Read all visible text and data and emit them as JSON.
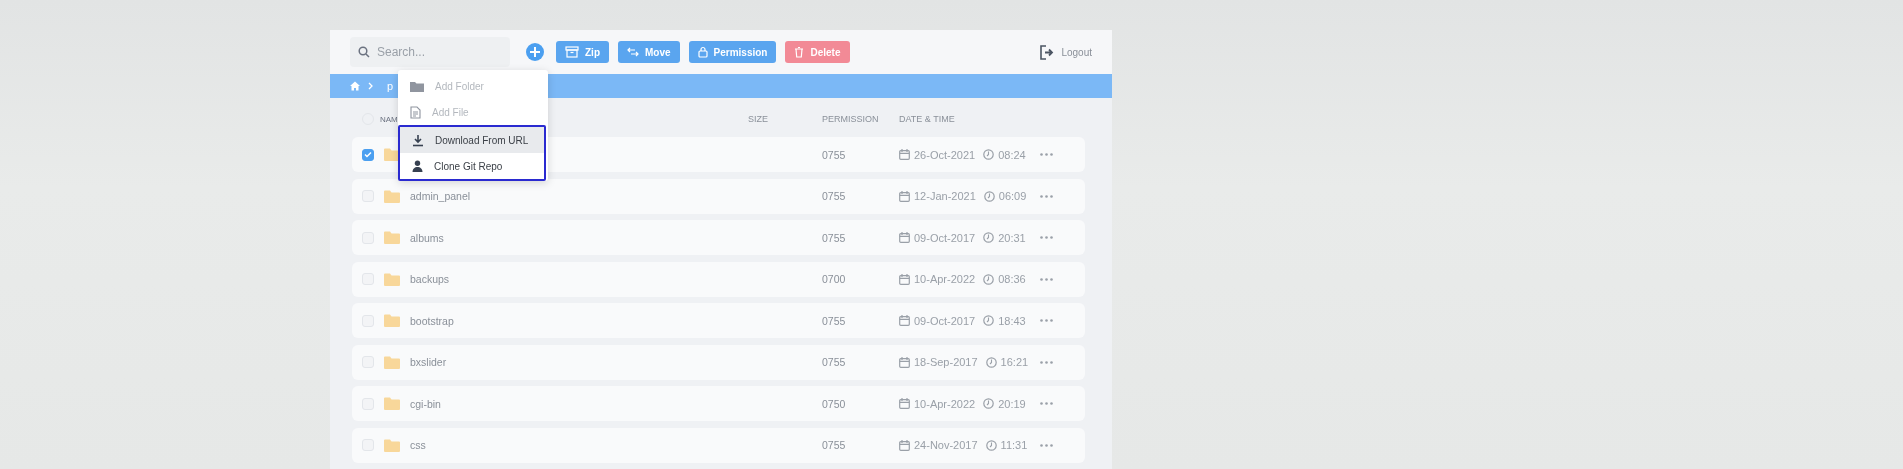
{
  "toolbar": {
    "search": {
      "placeholder": "Search..."
    },
    "buttons": [
      {
        "label": "Zip",
        "kind": "zip"
      },
      {
        "label": "Move",
        "kind": "move"
      },
      {
        "label": "Permission",
        "kind": "permission"
      },
      {
        "label": "Delete",
        "kind": "delete"
      }
    ],
    "logout": "Logout"
  },
  "breadcrumb": {
    "current": "p"
  },
  "add_menu": {
    "items": [
      {
        "label": "Add Folder",
        "kind": "folder",
        "selected": false,
        "disabled": true,
        "outlined": false
      },
      {
        "label": "Add File",
        "kind": "file",
        "selected": false,
        "disabled": true,
        "outlined": false
      },
      {
        "label": "Download From URL",
        "kind": "download",
        "selected": true,
        "disabled": false,
        "outlined": true
      },
      {
        "label": "Clone Git Repo",
        "kind": "user",
        "selected": false,
        "disabled": false,
        "outlined": true
      }
    ]
  },
  "table": {
    "select_all_checked": false,
    "columns": [
      "NAM",
      "SIZE",
      "PERMISSION",
      "DATE & TIME"
    ],
    "rows": [
      {
        "checked": true,
        "permission": "0755",
        "date": "26-Oct-2021",
        "time": "08:24"
      },
      {
        "checked": false,
        "name": "admin_panel",
        "permission": "0755",
        "date": "12-Jan-2021",
        "time": "06:09"
      },
      {
        "checked": false,
        "name": "albums",
        "permission": "0755",
        "date": "09-Oct-2017",
        "time": "20:31"
      },
      {
        "checked": false,
        "name": "backups",
        "permission": "0700",
        "date": "10-Apr-2022",
        "time": "08:36"
      },
      {
        "checked": false,
        "name": "bootstrap",
        "permission": "0755",
        "date": "09-Oct-2017",
        "time": "18:43"
      },
      {
        "checked": false,
        "name": "bxslider",
        "permission": "0755",
        "date": "18-Sep-2017",
        "time": "16:21"
      },
      {
        "checked": false,
        "name": "cgi-bin",
        "permission": "0750",
        "date": "10-Apr-2022",
        "time": "20:19"
      },
      {
        "checked": false,
        "name": "css",
        "permission": "0755",
        "date": "24-Nov-2017",
        "time": "11:31"
      }
    ]
  }
}
